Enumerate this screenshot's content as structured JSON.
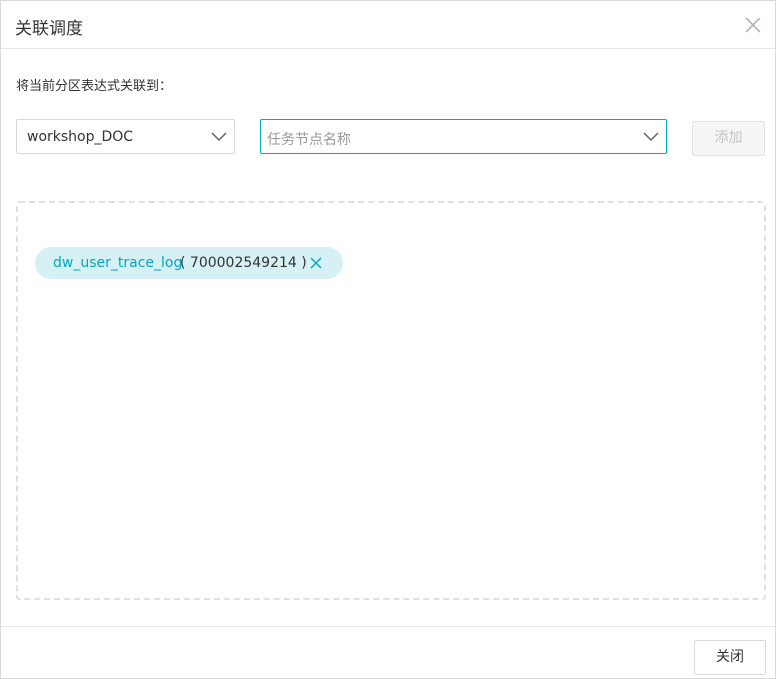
{
  "dialog": {
    "title": "关联调度",
    "close_icon": "close-icon"
  },
  "form": {
    "instruction": "将当前分区表达式关联到：",
    "project_select": {
      "value": "workshop_DOC",
      "icon": "chevron-down-icon"
    },
    "task_input": {
      "placeholder": "任务节点名称",
      "icon": "chevron-down-icon"
    },
    "add_button": {
      "label": "添加",
      "disabled": true
    }
  },
  "selected_tasks": [
    {
      "name": "dw_user_trace_log",
      "id": "( 700002549214 )",
      "remove_icon": "close-icon"
    }
  ],
  "footer": {
    "close_button": "关闭"
  },
  "colors": {
    "accent": "#00a8c4",
    "tag_background": "#d5f1f5",
    "border": "#d9d9d9"
  }
}
